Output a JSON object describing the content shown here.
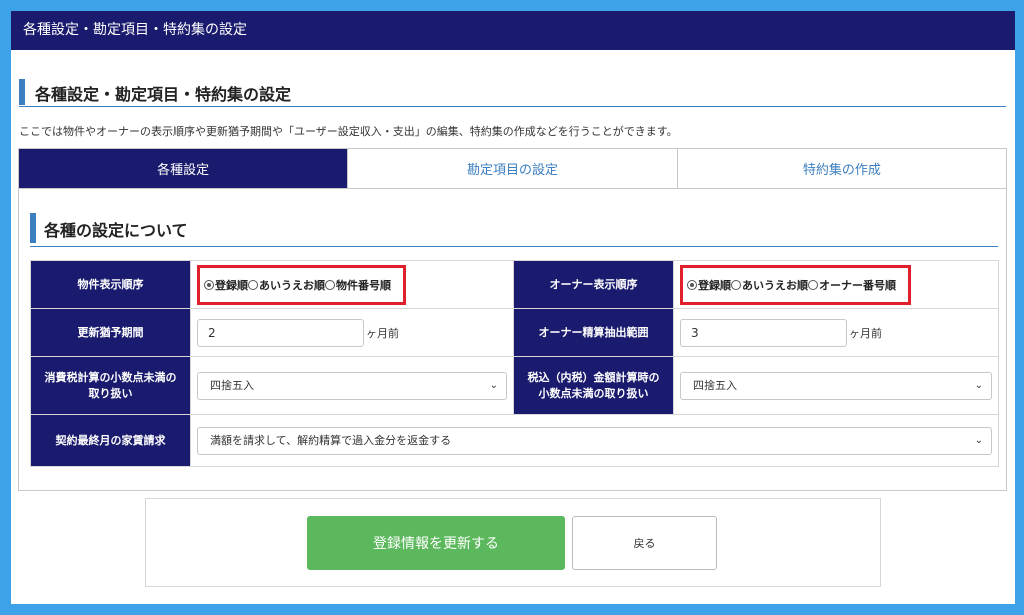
{
  "header": {
    "title": "各種設定・勘定項目・特約集の設定"
  },
  "page": {
    "heading": "各種設定・勘定項目・特約集の設定",
    "description": "ここでは物件やオーナーの表示順序や更新猶予期間や「ユーザー設定収入・支出」の編集、特約集の作成などを行うことができます。"
  },
  "tabs": [
    {
      "label": "各種設定",
      "active": true
    },
    {
      "label": "勘定項目の設定",
      "active": false
    },
    {
      "label": "特約集の作成",
      "active": false
    }
  ],
  "section": {
    "heading": "各種の設定について"
  },
  "settings": {
    "property_order": {
      "label": "物件表示順序",
      "options": [
        "登録順",
        "あいうえお順",
        "物件番号順"
      ],
      "selected": 0
    },
    "owner_order": {
      "label": "オーナー表示順序",
      "options": [
        "登録順",
        "あいうえお順",
        "オーナー番号順"
      ],
      "selected": 0
    },
    "renewal_grace": {
      "label": "更新猶予期間",
      "value": "2",
      "unit": "ヶ月前"
    },
    "owner_settlement": {
      "label": "オーナー精算抽出範囲",
      "value": "3",
      "unit": "ヶ月前"
    },
    "tax_rounding": {
      "label_line1": "消費税計算の小数点未満の",
      "label_line2": "取り扱い",
      "value": "四捨五入"
    },
    "tax_incl_rounding": {
      "label_line1": "税込（内税）金額計算時の",
      "label_line2": "小数点未満の取り扱い",
      "value": "四捨五入"
    },
    "final_month_rent": {
      "label": "契約最終月の家賃請求",
      "value": "満額を請求して、解約精算で過入金分を返金する"
    }
  },
  "buttons": {
    "update": "登録情報を更新する",
    "back": "戻る"
  },
  "colors": {
    "navy": "#1a1a6e",
    "accent": "#3c7fc0",
    "green": "#5cb85c",
    "highlight": "#e0202a",
    "background": "#3ea2e8"
  }
}
